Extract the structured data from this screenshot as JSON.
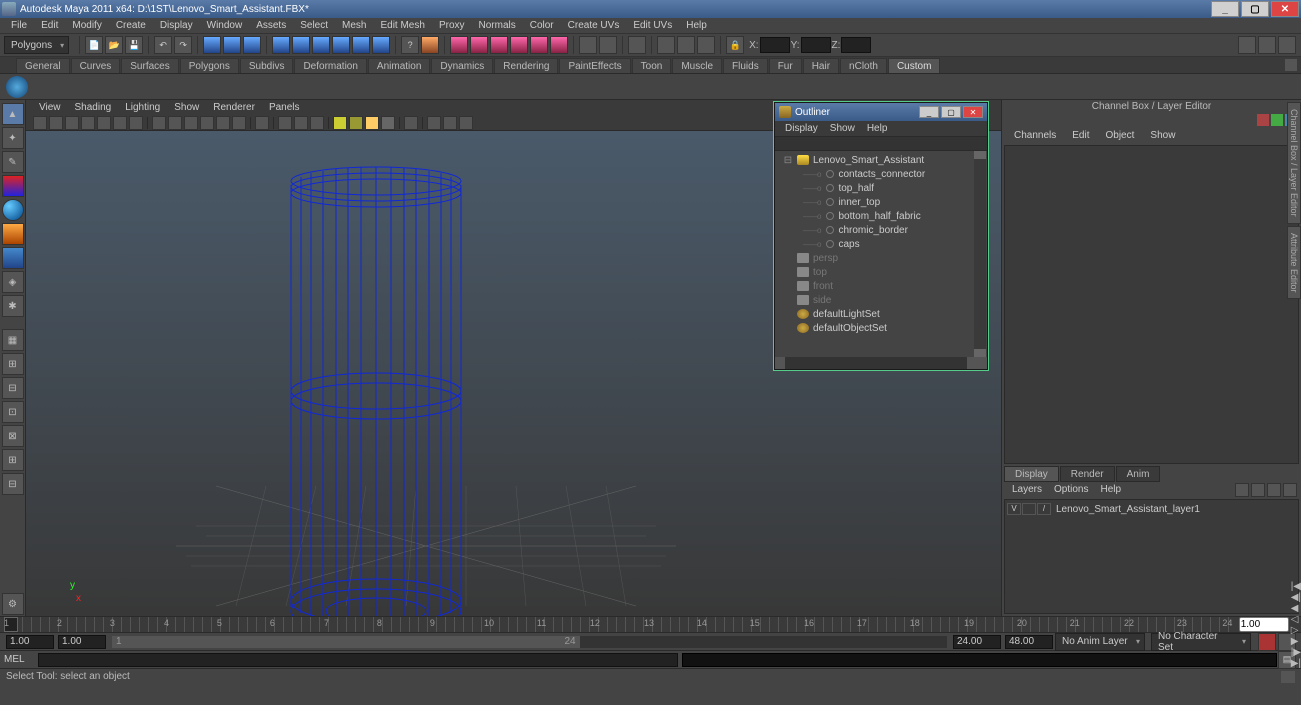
{
  "title": "Autodesk Maya 2011 x64: D:\\1ST\\Lenovo_Smart_Assistant.FBX*",
  "menubar": [
    "File",
    "Edit",
    "Modify",
    "Create",
    "Display",
    "Window",
    "Assets",
    "Select",
    "Mesh",
    "Edit Mesh",
    "Proxy",
    "Normals",
    "Color",
    "Create UVs",
    "Edit UVs",
    "Help"
  ],
  "mode_dropdown": "Polygons",
  "xyz_labels": {
    "x": "X:",
    "y": "Y:",
    "z": "Z:"
  },
  "shelf_tabs": [
    "General",
    "Curves",
    "Surfaces",
    "Polygons",
    "Subdivs",
    "Deformation",
    "Animation",
    "Dynamics",
    "Rendering",
    "PaintEffects",
    "Toon",
    "Muscle",
    "Fluids",
    "Fur",
    "Hair",
    "nCloth",
    "Custom"
  ],
  "shelf_active": "Custom",
  "viewport_menu": [
    "View",
    "Shading",
    "Lighting",
    "Show",
    "Renderer",
    "Panels"
  ],
  "axis": {
    "y": "y",
    "x": "x"
  },
  "outliner": {
    "title": "Outliner",
    "menu": [
      "Display",
      "Show",
      "Help"
    ],
    "items": [
      {
        "label": "Lenovo_Smart_Assistant",
        "type": "grp",
        "indent": 0,
        "exp": "⊟"
      },
      {
        "label": "contacts_connector",
        "type": "mesh",
        "indent": 1
      },
      {
        "label": "top_half",
        "type": "mesh",
        "indent": 1
      },
      {
        "label": "inner_top",
        "type": "mesh",
        "indent": 1
      },
      {
        "label": "bottom_half_fabric",
        "type": "mesh",
        "indent": 1
      },
      {
        "label": "chromic_border",
        "type": "mesh",
        "indent": 1
      },
      {
        "label": "caps",
        "type": "mesh",
        "indent": 1
      },
      {
        "label": "persp",
        "type": "cam",
        "indent": 0,
        "dim": true
      },
      {
        "label": "top",
        "type": "cam",
        "indent": 0,
        "dim": true
      },
      {
        "label": "front",
        "type": "cam",
        "indent": 0,
        "dim": true
      },
      {
        "label": "side",
        "type": "cam",
        "indent": 0,
        "dim": true
      },
      {
        "label": "defaultLightSet",
        "type": "set",
        "indent": 0
      },
      {
        "label": "defaultObjectSet",
        "type": "set",
        "indent": 0
      }
    ]
  },
  "channel_box": {
    "title": "Channel Box / Layer Editor",
    "tabs": [
      "Channels",
      "Edit",
      "Object",
      "Show"
    ]
  },
  "side_tabs": [
    "Channel Box / Layer Editor",
    "Attribute Editor"
  ],
  "layer_editor": {
    "tabs": [
      "Display",
      "Render",
      "Anim"
    ],
    "active": "Display",
    "menu": [
      "Layers",
      "Options",
      "Help"
    ],
    "layers": [
      {
        "vis": "V",
        "name": "Lenovo_Smart_Assistant_layer1"
      }
    ]
  },
  "timeline": {
    "marks": [
      "1",
      "2",
      "3",
      "4",
      "5",
      "6",
      "7",
      "8",
      "9",
      "10",
      "11",
      "12",
      "13",
      "14",
      "15",
      "16",
      "17",
      "18",
      "19",
      "20",
      "21",
      "22",
      "23",
      "24"
    ],
    "current_field": "1.00"
  },
  "range": {
    "start_outer": "1.00",
    "start_inner": "1.00",
    "slider_start": "1",
    "slider_end": "24",
    "end_inner": "24.00",
    "end_outer": "48.00",
    "anim_layer": "No Anim Layer",
    "char_set": "No Character Set"
  },
  "cmd": {
    "label": "MEL"
  },
  "status": "Select Tool: select an object"
}
